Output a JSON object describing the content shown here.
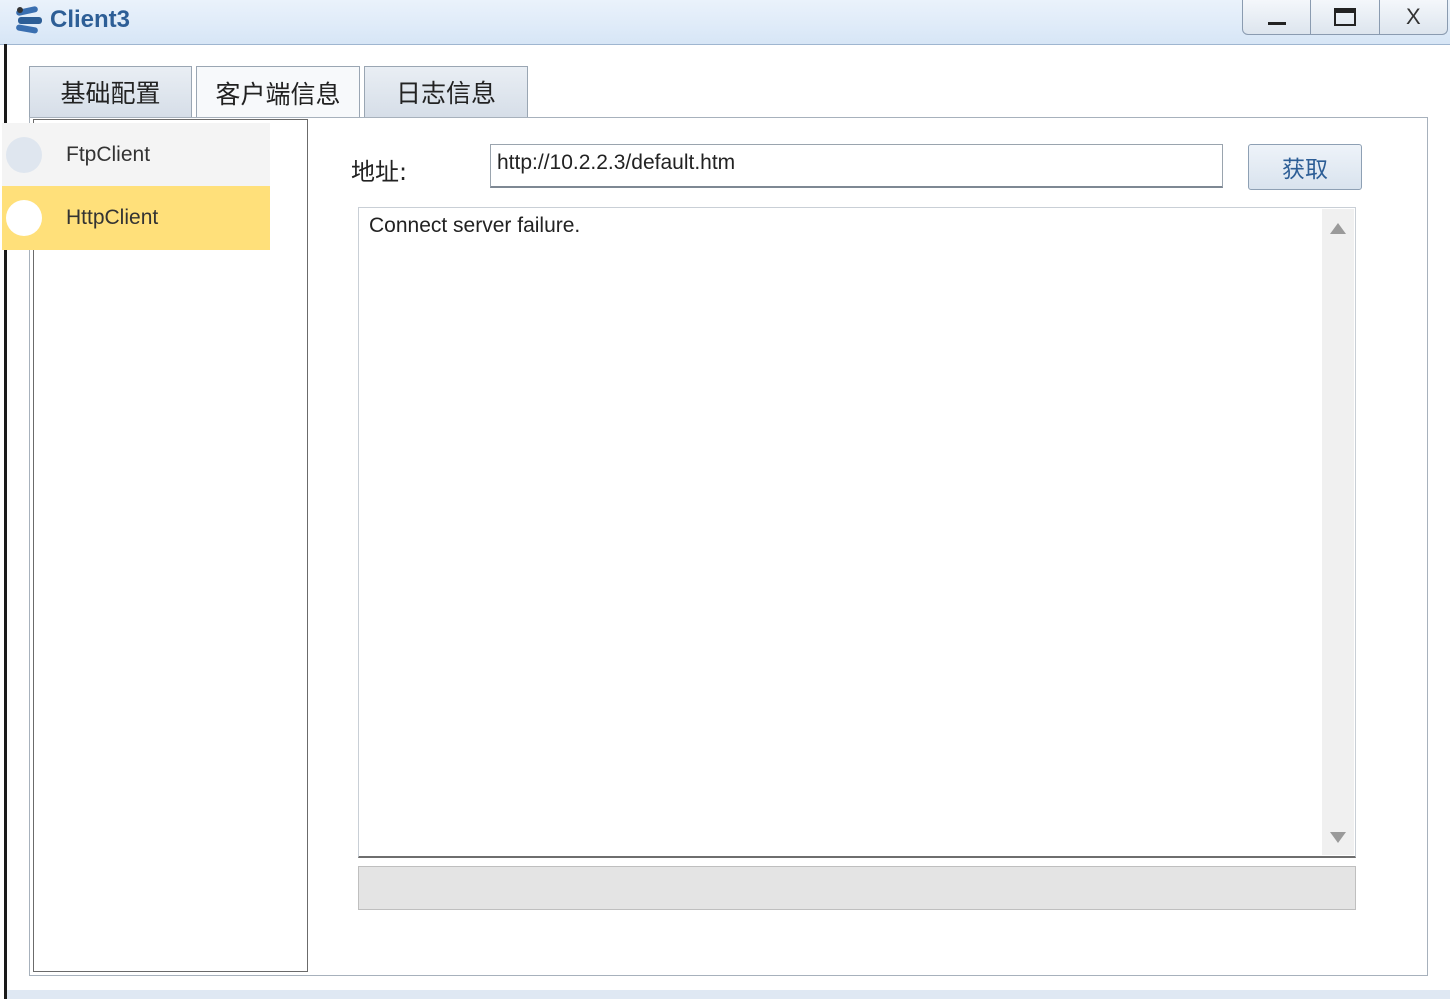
{
  "window": {
    "title": "Client3",
    "controls": {
      "minimize": "–",
      "maximize": "□",
      "close": "X"
    }
  },
  "tabs": [
    {
      "label": "基础配置"
    },
    {
      "label": "客户端信息"
    },
    {
      "label": "日志信息"
    }
  ],
  "clients": [
    {
      "label": "FtpClient"
    },
    {
      "label": "HttpClient"
    }
  ],
  "address": {
    "label": "地址:",
    "value": "http://10.2.2.3/default.htm",
    "get_button": "获取"
  },
  "output": {
    "text": "Connect server failure."
  },
  "icons": {
    "app": "client-app-icon",
    "scroll_up": "scroll-up-arrow-icon",
    "scroll_down": "scroll-down-arrow-icon"
  },
  "colors": {
    "selected_item": "#ffe07a",
    "title_text": "#2d5e96"
  }
}
